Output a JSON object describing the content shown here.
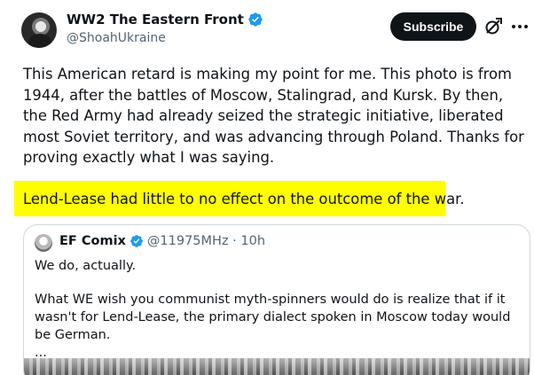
{
  "post": {
    "author_name": "WW2 The Eastern Front",
    "author_handle": "@ShoahUkraine",
    "subscribe_label": "Subscribe",
    "body": "This American retard is making my point for me. This photo is from 1944, after the battles of Moscow, Stalingrad, and Kursk. By then, the Red Army had already seized the strategic initiative, liberated most Soviet territory, and was advancing through Poland. Thanks for proving exactly what I was saying.",
    "highlighted_line": "Lend-Lease had little to no effect on the outcome of the war."
  },
  "quote": {
    "author_name": "EF Comix",
    "meta": "@11975MHz · 10h",
    "line1": "We do, actually.",
    "line2": "What WE wish you communist myth-spinners would do is realize that if it wasn't for Lend-Lease, the primary dialect spoken in Moscow today would be German.",
    "ellipsis": "..."
  },
  "colors": {
    "highlight": "#fefe00",
    "verified": "#1d9bf0",
    "subscribe_bg": "#0f1419",
    "secondary_text": "#536471"
  },
  "icons": {
    "verified": "verified-badge-icon",
    "grok": "grok-icon",
    "more": "more-options-icon"
  }
}
